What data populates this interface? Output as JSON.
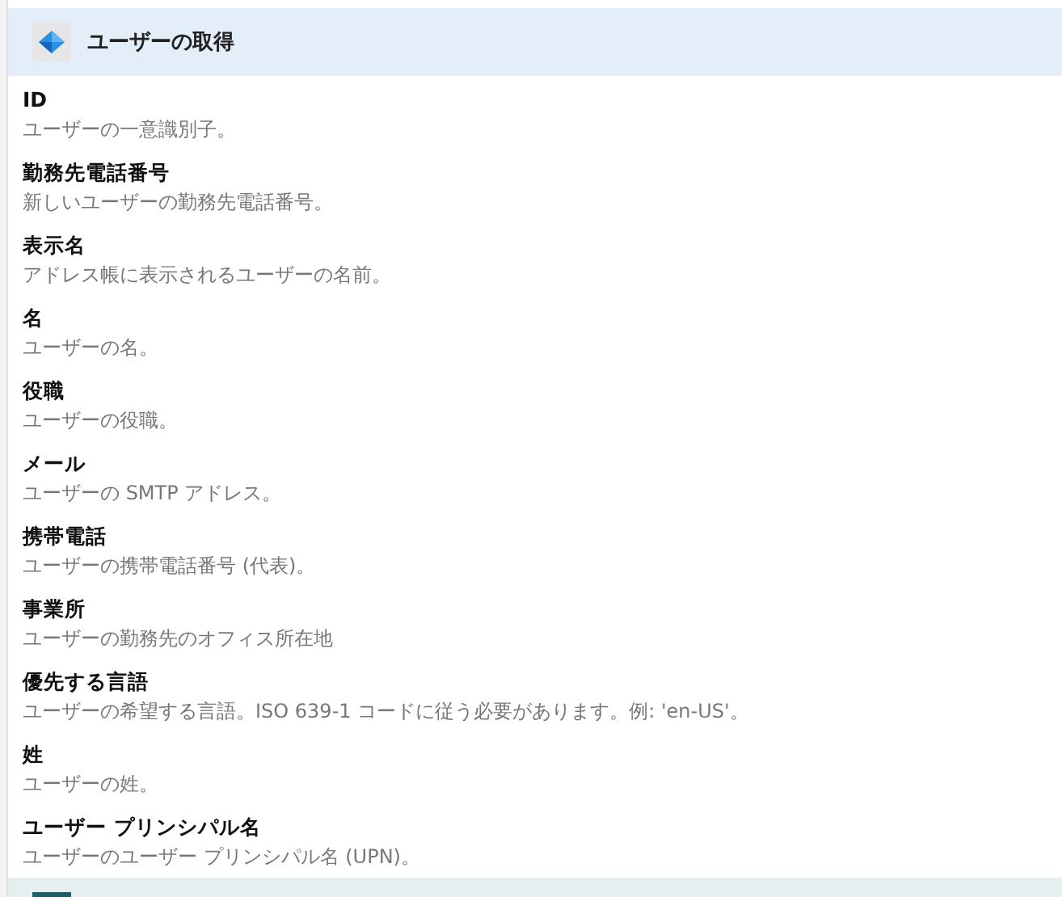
{
  "header": {
    "title": "ユーザーの取得"
  },
  "fields": [
    {
      "label": "ID",
      "description": "ユーザーの一意識別子。"
    },
    {
      "label": "勤務先電話番号",
      "description": "新しいユーザーの勤務先電話番号。"
    },
    {
      "label": "表示名",
      "description": "アドレス帳に表示されるユーザーの名前。"
    },
    {
      "label": "名",
      "description": "ユーザーの名。"
    },
    {
      "label": "役職",
      "description": "ユーザーの役職。"
    },
    {
      "label": "メール",
      "description": "ユーザーの SMTP アドレス。"
    },
    {
      "label": "携帯電話",
      "description": "ユーザーの携帯電話番号 (代表)。"
    },
    {
      "label": "事業所",
      "description": "ユーザーの勤務先のオフィス所在地"
    },
    {
      "label": "優先する言語",
      "description": "ユーザーの希望する言語。ISO 639-1 コードに従う必要があります。例: 'en-US'。"
    },
    {
      "label": "姓",
      "description": "ユーザーの姓。"
    },
    {
      "label": "ユーザー プリンシパル名",
      "description": "ユーザーのユーザー プリンシパル名 (UPN)。"
    }
  ]
}
